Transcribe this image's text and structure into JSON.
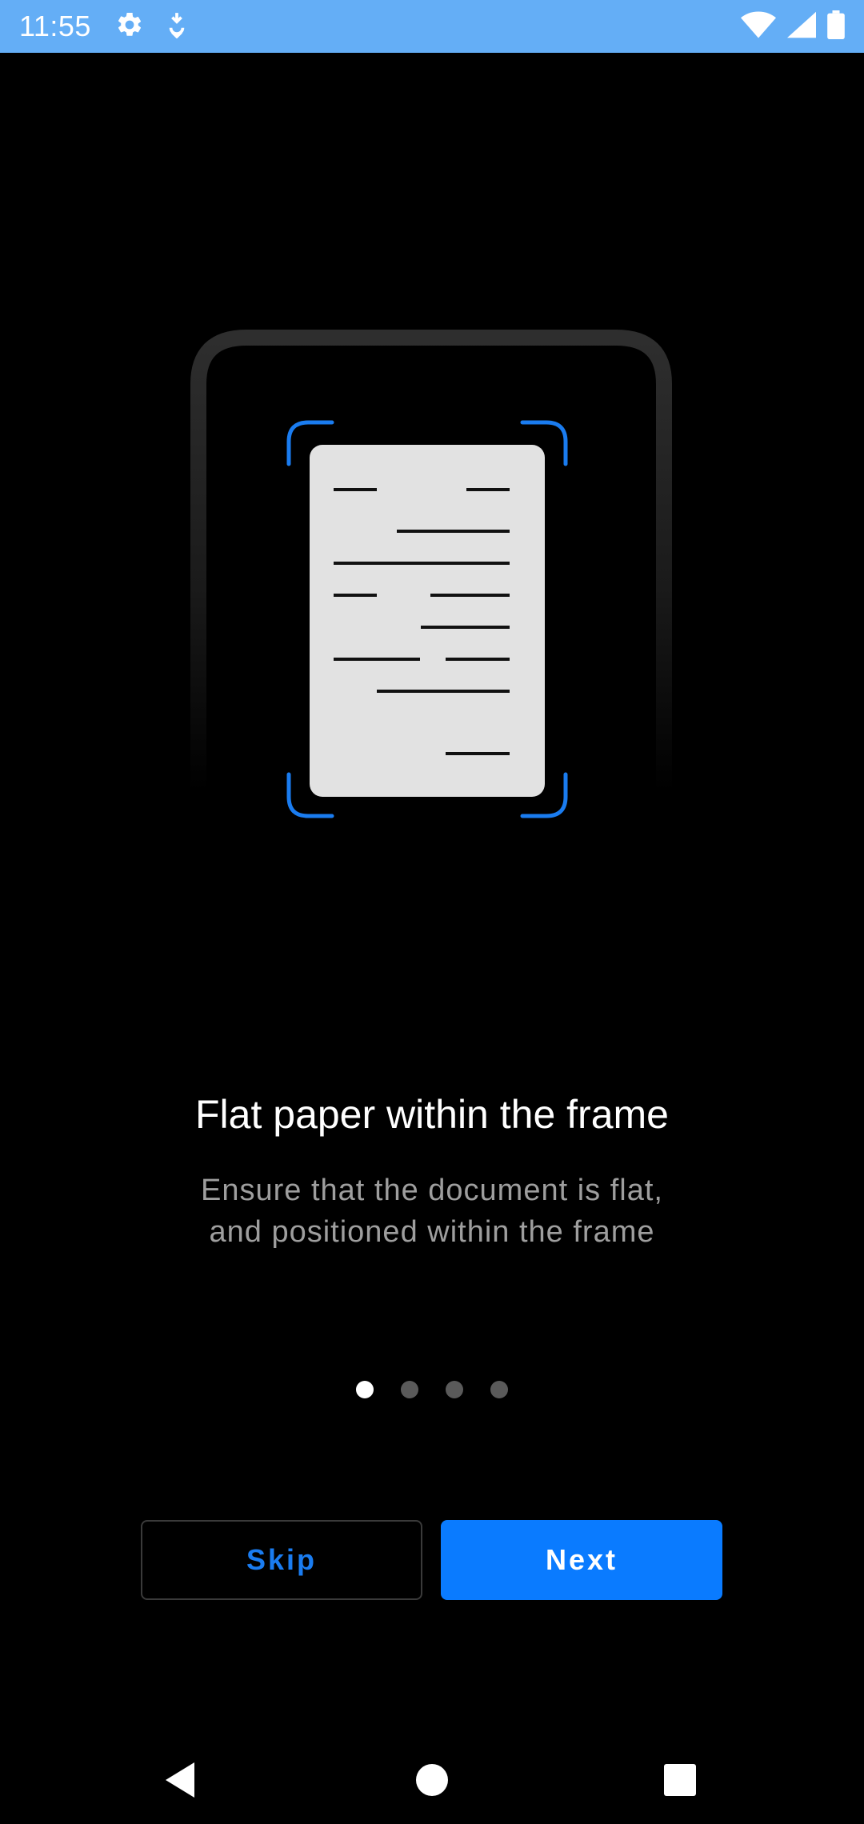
{
  "status_bar": {
    "time": "11:55",
    "left_icons": [
      "gear-icon",
      "download-icon"
    ],
    "right_icons": [
      "wifi-icon",
      "signal-icon",
      "battery-icon"
    ],
    "background": "#64aef6"
  },
  "onboarding": {
    "title": "Flat paper within the frame",
    "description_line1": "Ensure that the document is flat,",
    "description_line2": "and positioned within the frame",
    "page_count": 4,
    "current_page": 1
  },
  "buttons": {
    "skip_label": "Skip",
    "next_label": "Next"
  },
  "colors": {
    "accent": "#0a7bff",
    "frame_corner": "#1a7cf0",
    "document": "#e2e2e2"
  },
  "nav_bar": {
    "icons": [
      "back-icon",
      "home-icon",
      "recents-icon"
    ]
  }
}
